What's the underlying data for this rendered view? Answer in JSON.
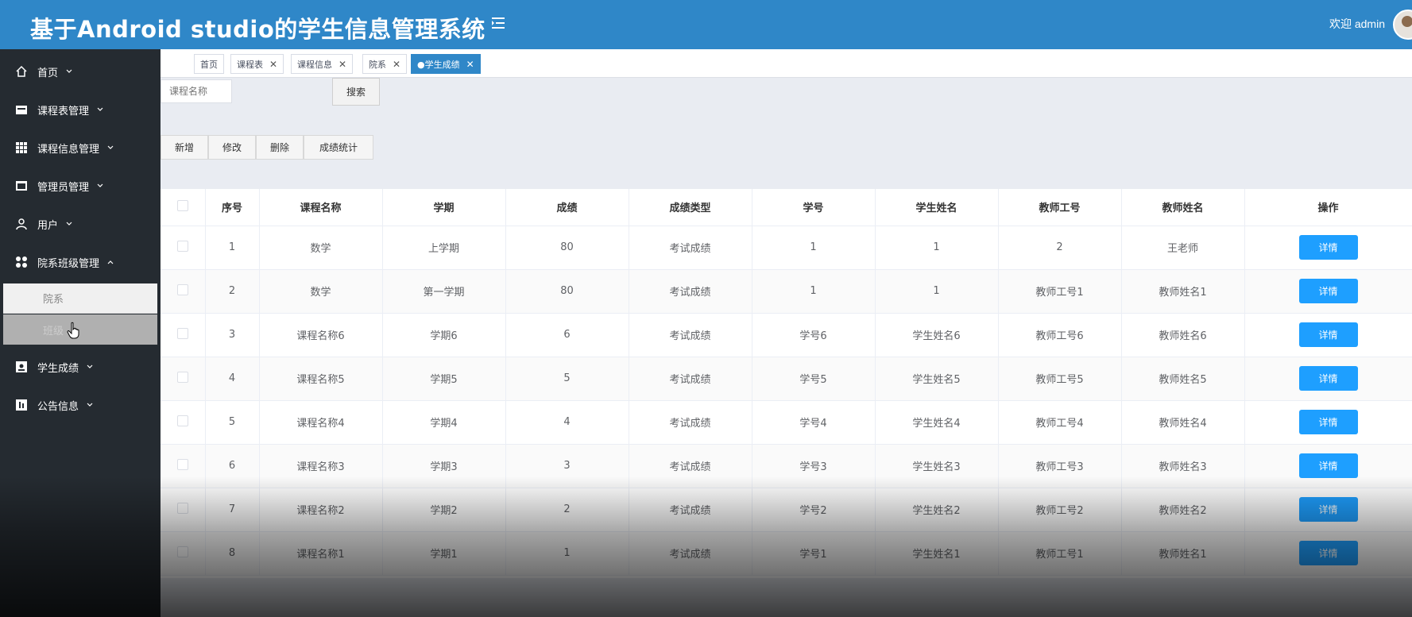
{
  "header": {
    "title": "基于Android studio的学生信息管理系统",
    "welcome": "欢迎 admin"
  },
  "sidebar": {
    "items": [
      {
        "label": "首页",
        "icon": "home-icon"
      },
      {
        "label": "课程表管理",
        "icon": "calendar-icon"
      },
      {
        "label": "课程信息管理",
        "icon": "grid-icon"
      },
      {
        "label": "管理员管理",
        "icon": "window-icon"
      },
      {
        "label": "用户",
        "icon": "user-icon"
      },
      {
        "label": "院系班级管理",
        "icon": "apps-icon"
      },
      {
        "label": "学生成绩",
        "icon": "id-card-icon"
      },
      {
        "label": "公告信息",
        "icon": "notice-icon"
      }
    ],
    "sub_items": [
      {
        "label": "院系"
      },
      {
        "label": "班级"
      }
    ]
  },
  "tabs": [
    {
      "label": "首页"
    },
    {
      "label": "课程表"
    },
    {
      "label": "课程信息"
    },
    {
      "label": "院系"
    },
    {
      "label": "●学生成绩"
    }
  ],
  "search": {
    "placeholder": "课程名称",
    "button": "搜索"
  },
  "actions": {
    "add": "新增",
    "edit": "修改",
    "delete": "删除",
    "stats": "成绩统计"
  },
  "table": {
    "headers": [
      "序号",
      "课程名称",
      "学期",
      "成绩",
      "成绩类型",
      "学号",
      "学生姓名",
      "教师工号",
      "教师姓名",
      "操作"
    ],
    "detail_label": "详情",
    "rows": [
      [
        "1",
        "数学",
        "上学期",
        "80",
        "考试成绩",
        "1",
        "1",
        "2",
        "王老师"
      ],
      [
        "2",
        "数学",
        "第一学期",
        "80",
        "考试成绩",
        "1",
        "1",
        "教师工号1",
        "教师姓名1"
      ],
      [
        "3",
        "课程名称6",
        "学期6",
        "6",
        "考试成绩",
        "学号6",
        "学生姓名6",
        "教师工号6",
        "教师姓名6"
      ],
      [
        "4",
        "课程名称5",
        "学期5",
        "5",
        "考试成绩",
        "学号5",
        "学生姓名5",
        "教师工号5",
        "教师姓名5"
      ],
      [
        "5",
        "课程名称4",
        "学期4",
        "4",
        "考试成绩",
        "学号4",
        "学生姓名4",
        "教师工号4",
        "教师姓名4"
      ],
      [
        "6",
        "课程名称3",
        "学期3",
        "3",
        "考试成绩",
        "学号3",
        "学生姓名3",
        "教师工号3",
        "教师姓名3"
      ],
      [
        "7",
        "课程名称2",
        "学期2",
        "2",
        "考试成绩",
        "学号2",
        "学生姓名2",
        "教师工号2",
        "教师姓名2"
      ],
      [
        "8",
        "课程名称1",
        "学期1",
        "1",
        "考试成绩",
        "学号1",
        "学生姓名1",
        "教师工号1",
        "教师姓名1"
      ]
    ]
  },
  "colors": {
    "header": "#2f87c8",
    "sidebar": "#252b31",
    "primary_button": "#1e9fff"
  }
}
